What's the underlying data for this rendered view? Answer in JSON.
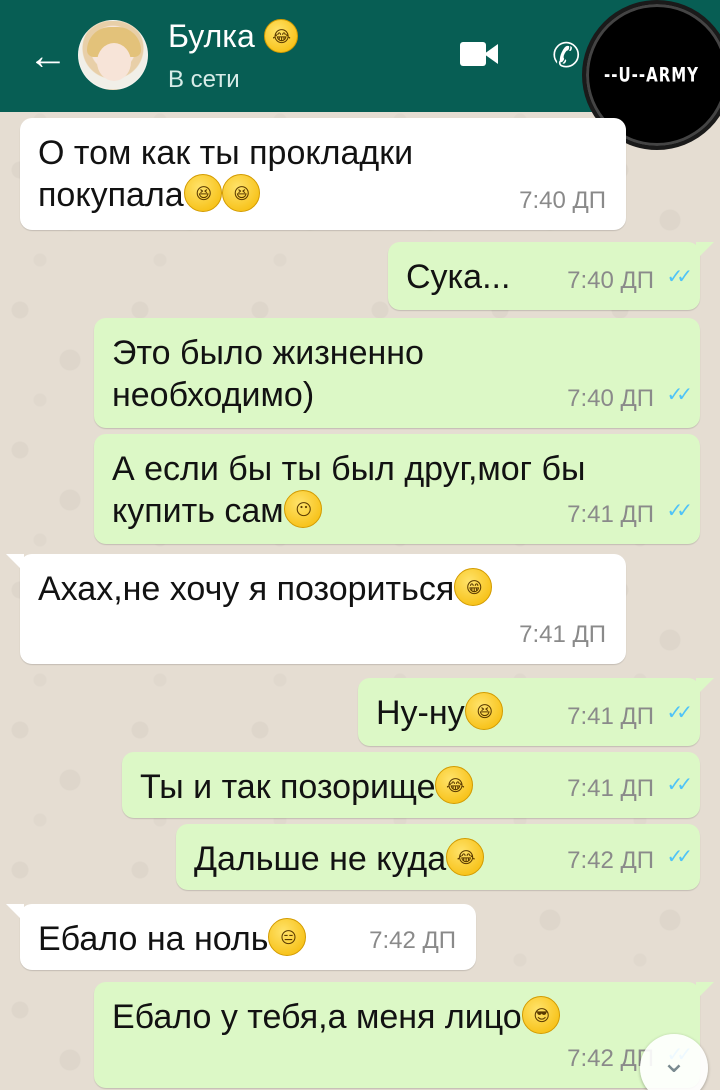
{
  "header": {
    "contact_name": "Булка",
    "contact_status": "В сети",
    "back_icon": "arrow-left-icon",
    "video_icon": "video-call-icon",
    "call_icon": "phone-icon",
    "menu_icon": "more-vert-icon",
    "bg_color": "#075e54"
  },
  "watermark": {
    "text": "--U--ARMY"
  },
  "messages": [
    {
      "dir": "in",
      "text": "О том как ты прокладки\nпокупала",
      "emoji": [
        "laughing",
        "laughing"
      ],
      "time": "7:40 ДП"
    },
    {
      "dir": "out",
      "text": "Сука...",
      "emoji": [],
      "time": "7:40 ДП",
      "read": true
    },
    {
      "dir": "out",
      "text": "Это было жизненно\nнеобходимо)",
      "emoji": [],
      "time": "7:40 ДП",
      "read": true
    },
    {
      "dir": "out",
      "text": "А если бы ты был друг,мог бы\nкупить сам",
      "emoji": [
        "hushed"
      ],
      "time": "7:41 ДП",
      "read": true
    },
    {
      "dir": "in",
      "text": "Ахах,не хочу я позориться",
      "emoji": [
        "grin"
      ],
      "time": "7:41 ДП"
    },
    {
      "dir": "out",
      "text": "Ну-ну",
      "emoji": [
        "laughing"
      ],
      "time": "7:41 ДП",
      "read": true
    },
    {
      "dir": "out",
      "text": "Ты и так позорище",
      "emoji": [
        "tears-of-joy"
      ],
      "time": "7:41 ДП",
      "read": true
    },
    {
      "dir": "out",
      "text": "Дальше не куда",
      "emoji": [
        "tears-of-joy"
      ],
      "time": "7:42 ДП",
      "read": true
    },
    {
      "dir": "in",
      "text": "Ебало на ноль",
      "emoji": [
        "expressionless"
      ],
      "time": "7:42 ДП"
    },
    {
      "dir": "out",
      "text": "Ебало у тебя,а меня лицо",
      "emoji": [
        "sunglasses"
      ],
      "time": "7:42 ДП",
      "read": true
    }
  ],
  "scroll_down_icon": "double-chevron-down-icon",
  "colors": {
    "incoming": "#ffffff",
    "outgoing": "#dcf8c6",
    "read_checks": "#4fc3f7"
  }
}
